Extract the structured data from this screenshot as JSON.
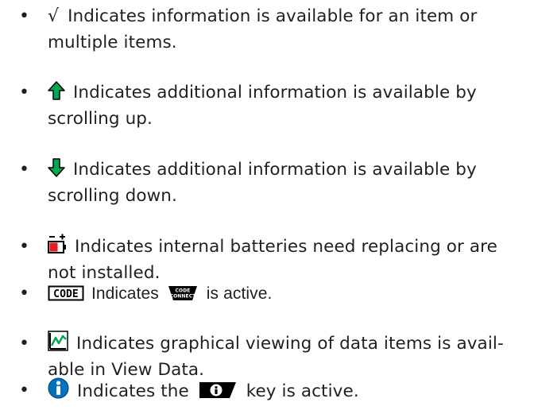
{
  "items": [
    {
      "icon": "check-icon",
      "glyph": "√",
      "line1": "Indicates information is available for an item or",
      "line2": "multiple items."
    },
    {
      "icon": "up-arrow-icon",
      "line1": "Indicates additional information is available by",
      "line2": "scrolling up."
    },
    {
      "icon": "down-arrow-icon",
      "line1": "Indicates additional information is available by",
      "line2": "scrolling down."
    },
    {
      "icon": "battery-icon",
      "line1": "Indicates internal batteries need replacing or are",
      "line2": "not installed."
    },
    {
      "icon": "code-icon",
      "badge_text": "CODE",
      "text_a": "Indicates",
      "connect_badge": [
        "CODE",
        "CONNECT"
      ],
      "text_b": "is active."
    },
    {
      "icon": "graph-icon",
      "line1": "Indicates graphical viewing of data items is avail-",
      "line2": "able in View Data."
    },
    {
      "icon": "info-icon",
      "text_a": "Indicates the",
      "key_icon": "info-key-icon",
      "text_b": "key is active."
    }
  ],
  "bullet": "•",
  "colors": {
    "green_arrow": "#00a651",
    "red_battery": "#e31b23",
    "blue_info": "#0072bc",
    "text": "#231f20"
  }
}
